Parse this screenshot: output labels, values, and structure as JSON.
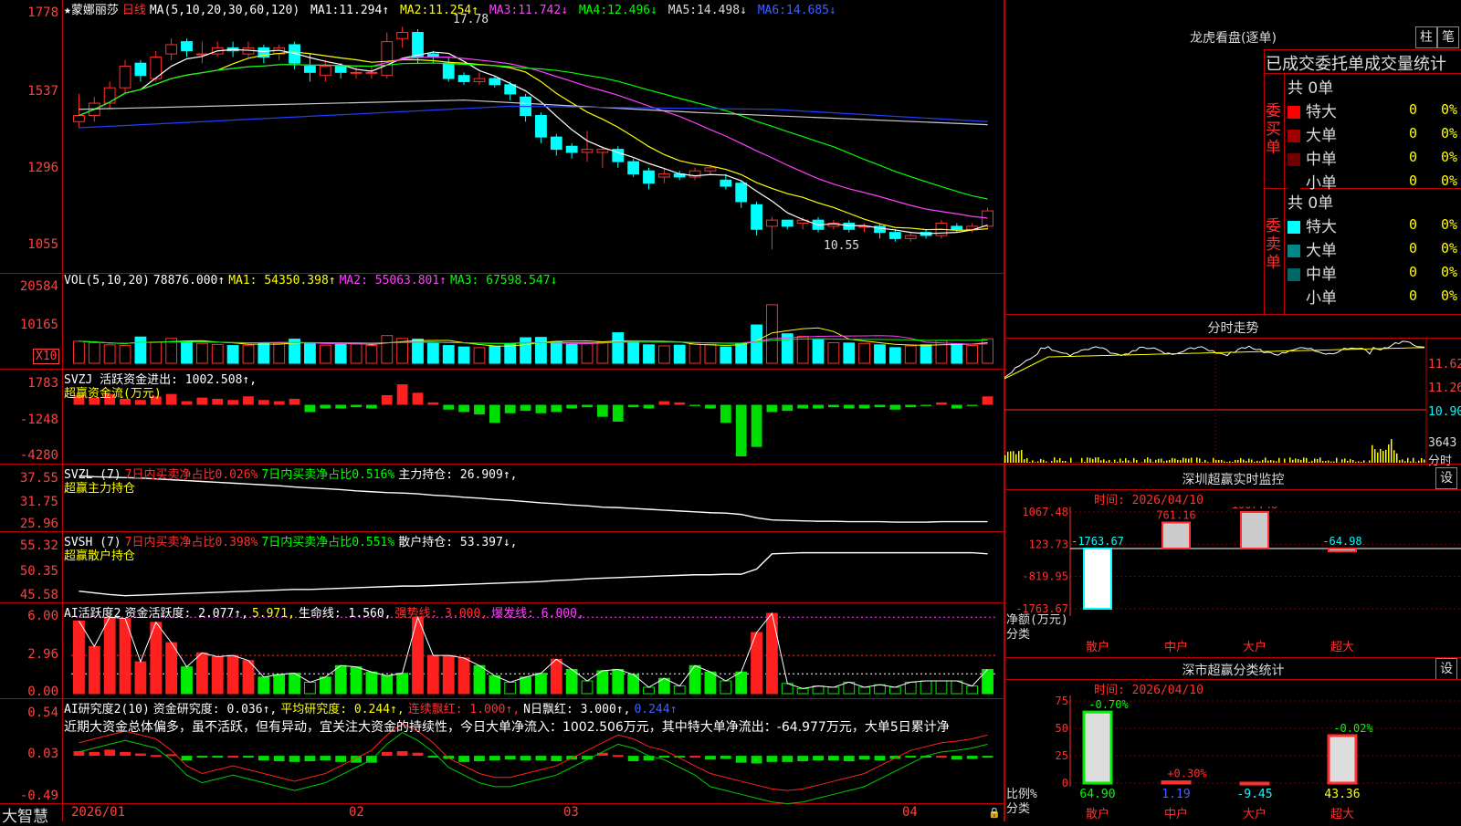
{
  "stock": {
    "name": "★蒙娜丽莎",
    "period": "日线"
  },
  "price_panel": {
    "ma_prefix": "MA(5,10,20,30,60,120)",
    "ma": [
      {
        "label": "MA1:",
        "value": "11.294↑",
        "color": "#ffffff"
      },
      {
        "label": "MA2:",
        "value": "11.254↑",
        "color": "#ffff00"
      },
      {
        "label": "MA3:",
        "value": "11.742↓",
        "color": "#ff40ff"
      },
      {
        "label": "MA4:",
        "value": "12.496↓",
        "color": "#00ff00"
      },
      {
        "label": "MA5:",
        "value": "14.498↓",
        "color": "#dddddd"
      },
      {
        "label": "MA6:",
        "value": "14.685↓",
        "color": "#4060ff"
      }
    ],
    "y_ticks": [
      "1778",
      "1537",
      "1296",
      "1055"
    ],
    "high_mark": "17.78",
    "low_mark": "10.55"
  },
  "vol_panel": {
    "prefix": "VOL(5,10,20)",
    "value": "78876.000↑",
    "ma1": "MA1: 54350.398↑",
    "ma2": "MA2: 55063.801↑",
    "ma3": "MA3: 67598.547↓",
    "y_ticks": [
      "20584",
      "10165"
    ],
    "unit": "X10"
  },
  "svzj_panel": {
    "line1": "SVZJ  活跃资金进出: 1002.508↑,",
    "line2": "超赢资金流(万元)",
    "y_ticks": [
      "1783",
      "-1248",
      "-4280"
    ]
  },
  "svzl_panel": {
    "prefix": "SVZL (7)",
    "a": "7日内买卖净占比0.026%",
    "b": "7日内买卖净占比0.516%",
    "c": "主力持仓: 26.909↑,",
    "line2": "超赢主力持仓",
    "y_ticks": [
      "37.55",
      "31.75",
      "25.96"
    ]
  },
  "svsh_panel": {
    "prefix": "SVSH (7)",
    "a": "7日内买卖净占比0.398%",
    "b": "7日内买卖净占比0.551%",
    "c": "散户持仓: 53.397↓,",
    "line2": "超赢散户持仓",
    "y_ticks": [
      "55.32",
      "50.35",
      "45.58"
    ]
  },
  "ai_panel": {
    "prefix": "AI活跃度2",
    "a": "资金活跃度: 2.077↑,",
    "b": "5.971,",
    "c": "生命线: 1.560,",
    "d": "强势线: 3.000,",
    "e": "爆发线: 6.000,",
    "y_ticks": [
      "6.00",
      "2.96",
      "0.00"
    ]
  },
  "ai2_panel": {
    "prefix": "AI研究度2(10)",
    "a": "资金研究度: 0.036↑,",
    "b": "平均研究度: 0.244↑,",
    "c": "连续飘红: 1.000↑,",
    "d": "N日飘红: 3.000↑,",
    "e": "0.244↑",
    "desc": "近期大资金总体偏多，虽不活跃，但有异动，宜关注大资金的持续性，今日大单净流入：1002.506万元，其中特大单净流出：-64.977万元，大单5日累计净",
    "y_ticks": [
      "0.54",
      "0.03",
      "-0.49"
    ]
  },
  "x_axis": {
    "brand": "大智慧",
    "labels": [
      "2026/01",
      "02",
      "03",
      "04"
    ]
  },
  "dragon": {
    "title": "龙虎看盘(逐单)",
    "btn1": "柱",
    "btn2": "笔",
    "header": "已成交委托单成交量统计",
    "buy": {
      "side": "委买单",
      "total": "共 0单",
      "rows": [
        {
          "label": "特大",
          "count": "0",
          "pct": "0%",
          "color": "#ff0000"
        },
        {
          "label": "大单",
          "count": "0",
          "pct": "0%",
          "color": "#a00000"
        },
        {
          "label": "中单",
          "count": "0",
          "pct": "0%",
          "color": "#700000"
        },
        {
          "label": "小单",
          "count": "0",
          "pct": "0%",
          "color": "#000000"
        }
      ]
    },
    "sell": {
      "side": "委卖单",
      "total": "共 0单",
      "rows": [
        {
          "label": "特大",
          "count": "0",
          "pct": "0%",
          "color": "#00ffff"
        },
        {
          "label": "大单",
          "count": "0",
          "pct": "0%",
          "color": "#008888"
        },
        {
          "label": "中单",
          "count": "0",
          "pct": "0%",
          "color": "#006666"
        },
        {
          "label": "小单",
          "count": "0",
          "pct": "0%",
          "color": "#000000"
        }
      ]
    }
  },
  "intraday": {
    "title": "分时走势",
    "labels": [
      "11.62",
      "11.26",
      "10.90",
      "3643",
      "分时"
    ]
  },
  "sz_monitor": {
    "title": "深圳超赢实时监控",
    "btn": "设",
    "time": "时间: 2026/04/10",
    "y_ticks": [
      "1067.48",
      "123.73",
      "-819.95",
      "-1763.67"
    ],
    "y_name": "净额(万元)",
    "x_name": "分类",
    "bars": [
      {
        "cat": "散户",
        "value": "-1763.67"
      },
      {
        "cat": "中户",
        "value": "761.16"
      },
      {
        "cat": "大户",
        "value": "1067.48"
      },
      {
        "cat": "超大",
        "value": "-64.98"
      }
    ]
  },
  "sz_stats": {
    "title": "深市超赢分类统计",
    "btn": "设",
    "time": "时间: 2026/04/10",
    "y_ticks": [
      "75",
      "50",
      "25",
      "0"
    ],
    "y_name": "比例%",
    "x_name": "分类",
    "bars": [
      {
        "cat": "散户",
        "pct": "-0.70%",
        "value": "64.90"
      },
      {
        "cat": "中户",
        "pct": "+0.30%",
        "value": "1.19"
      },
      {
        "cat": "大户",
        "pct": "",
        "value": "-9.45"
      },
      {
        "cat": "超大",
        "pct": "-0.02%",
        "value": "43.36"
      }
    ]
  },
  "chart_data": [
    {
      "type": "candlestick",
      "title": "蒙娜丽莎 日线",
      "ylim": [
        10.2,
        18.0
      ],
      "candles": [
        [
          14.7,
          14.9,
          14.5,
          15.6
        ],
        [
          14.9,
          15.3,
          14.7,
          15.5
        ],
        [
          15.3,
          15.8,
          15.1,
          16.0
        ],
        [
          15.8,
          16.5,
          15.6,
          16.7
        ],
        [
          16.6,
          16.2,
          16.0,
          16.7
        ],
        [
          16.1,
          16.8,
          16.0,
          17.0
        ],
        [
          16.9,
          17.2,
          16.7,
          17.4
        ],
        [
          17.3,
          17.0,
          16.8,
          17.4
        ],
        [
          16.9,
          16.9,
          16.6,
          17.3
        ],
        [
          16.9,
          17.1,
          16.8,
          17.3
        ],
        [
          17.1,
          17.0,
          16.8,
          17.3
        ],
        [
          16.9,
          17.1,
          16.8,
          17.3
        ],
        [
          17.1,
          16.8,
          16.6,
          17.2
        ],
        [
          16.9,
          17.1,
          16.7,
          17.2
        ],
        [
          17.2,
          16.6,
          16.4,
          17.3
        ],
        [
          16.5,
          16.3,
          16.0,
          16.9
        ],
        [
          16.2,
          16.5,
          16.0,
          16.7
        ],
        [
          16.5,
          16.3,
          16.1,
          16.6
        ],
        [
          16.3,
          16.3,
          16.1,
          16.5
        ],
        [
          16.3,
          16.3,
          16.1,
          16.5
        ],
        [
          16.2,
          17.3,
          16.1,
          17.6
        ],
        [
          17.4,
          17.6,
          17.1,
          17.78
        ],
        [
          17.6,
          16.8,
          16.6,
          17.7
        ],
        [
          16.9,
          16.8,
          16.6,
          17.0
        ],
        [
          16.6,
          16.1,
          16.0,
          16.8
        ],
        [
          16.2,
          16.0,
          15.9,
          16.3
        ],
        [
          16.0,
          16.1,
          15.9,
          16.3
        ],
        [
          16.1,
          15.9,
          15.8,
          16.2
        ],
        [
          15.9,
          15.6,
          15.4,
          16.0
        ],
        [
          15.5,
          14.9,
          14.7,
          15.6
        ],
        [
          14.9,
          14.2,
          14.0,
          15.0
        ],
        [
          14.2,
          13.8,
          13.6,
          14.3
        ],
        [
          13.9,
          13.7,
          13.5,
          14.0
        ],
        [
          13.7,
          13.8,
          13.4,
          14.4
        ],
        [
          13.7,
          13.8,
          13.2,
          13.9
        ],
        [
          13.8,
          13.4,
          13.2,
          13.9
        ],
        [
          13.4,
          13.0,
          12.9,
          13.5
        ],
        [
          13.1,
          12.7,
          12.5,
          13.2
        ],
        [
          12.9,
          13.0,
          12.7,
          13.2
        ],
        [
          13.0,
          12.9,
          12.8,
          13.1
        ],
        [
          12.9,
          13.1,
          12.8,
          13.2
        ],
        [
          13.1,
          13.2,
          13.0,
          13.3
        ],
        [
          12.8,
          12.6,
          12.5,
          13.0
        ],
        [
          12.7,
          12.1,
          11.9,
          12.8
        ],
        [
          12.0,
          11.2,
          11.0,
          12.1
        ],
        [
          11.3,
          11.5,
          10.55,
          11.6
        ],
        [
          11.5,
          11.3,
          11.2,
          11.5
        ],
        [
          11.4,
          11.5,
          11.2,
          11.6
        ],
        [
          11.5,
          11.2,
          11.1,
          11.6
        ],
        [
          11.3,
          11.4,
          11.2,
          11.5
        ],
        [
          11.4,
          11.2,
          11.1,
          11.5
        ],
        [
          11.3,
          11.3,
          11.1,
          11.4
        ],
        [
          11.3,
          11.1,
          10.9,
          11.4
        ],
        [
          11.1,
          10.9,
          10.8,
          11.2
        ],
        [
          10.9,
          11.0,
          10.8,
          11.1
        ],
        [
          11.1,
          11.0,
          10.9,
          11.2
        ],
        [
          11.0,
          11.4,
          10.9,
          11.5
        ],
        [
          11.3,
          11.2,
          11.1,
          11.4
        ],
        [
          11.2,
          11.3,
          11.1,
          11.4
        ],
        [
          11.3,
          11.8,
          11.2,
          11.9
        ]
      ]
    },
    {
      "type": "bar",
      "title": "VOL",
      "ylim": [
        0,
        20584
      ],
      "values": [
        6200,
        5800,
        5200,
        5000,
        7400,
        6000,
        7000,
        5900,
        5600,
        5300,
        5000,
        5100,
        5800,
        5700,
        6800,
        5500,
        5100,
        5300,
        5400,
        5000,
        7800,
        7000,
        6800,
        5600,
        5000,
        4600,
        4400,
        4800,
        5400,
        7200,
        7300,
        6100,
        5300,
        5600,
        5900,
        8600,
        6200,
        5200,
        4900,
        5100,
        5400,
        5300,
        4600,
        5600,
        10800,
        16500,
        8300,
        7600,
        6600,
        5800,
        5700,
        5600,
        5200,
        4400,
        4900,
        5200,
        6400,
        5500,
        5000,
        6900
      ]
    },
    {
      "type": "bar",
      "title": "超赢资金流(万元)",
      "ylim": [
        -4280,
        1783
      ],
      "values": [
        800,
        600,
        900,
        500,
        400,
        700,
        900,
        300,
        600,
        500,
        400,
        700,
        400,
        300,
        500,
        -600,
        -300,
        -300,
        -200,
        -300,
        800,
        1700,
        1000,
        200,
        -400,
        -600,
        -800,
        -1500,
        -700,
        -500,
        -700,
        -600,
        -300,
        -200,
        -1000,
        -1400,
        -200,
        -300,
        300,
        200,
        -100,
        -300,
        -1500,
        -4280,
        -3500,
        -600,
        -500,
        -300,
        -300,
        -200,
        -300,
        -300,
        -200,
        -400,
        -200,
        -100,
        200,
        -300,
        -100,
        700
      ]
    },
    {
      "type": "bar",
      "title": "AI活跃度2",
      "ylim": [
        0,
        6.0
      ],
      "values": [
        5.7,
        3.7,
        6.0,
        5.9,
        2.5,
        5.6,
        4.0,
        2.1,
        3.2,
        2.9,
        3.0,
        2.6,
        1.3,
        1.5,
        1.6,
        0.9,
        1.3,
        2.2,
        2.1,
        1.7,
        1.4,
        1.6,
        6.0,
        3.0,
        3.0,
        2.8,
        2.2,
        1.4,
        0.9,
        1.3,
        1.6,
        2.7,
        1.9,
        1.0,
        1.8,
        1.9,
        1.5,
        0.5,
        1.2,
        0.6,
        2.2,
        1.7,
        1.0,
        1.7,
        4.8,
        6.3,
        0.8,
        0.4,
        0.6,
        0.5,
        0.9,
        0.5,
        0.7,
        0.5,
        0.9,
        1.0,
        1.0,
        1.0,
        0.6,
        1.9
      ]
    },
    {
      "type": "bar",
      "title": "AI研究度2(10)",
      "ylim": [
        -0.49,
        0.54
      ],
      "values": [
        0.09,
        0.08,
        0.11,
        0.08,
        0.06,
        0.04,
        0.05,
        -0.03,
        0.02,
        0.02,
        0.03,
        0.02,
        -0.03,
        -0.04,
        -0.05,
        -0.04,
        -0.03,
        -0.05,
        -0.06,
        -0.06,
        0.08,
        0.09,
        0.07,
        0.02,
        -0.01,
        -0.05,
        -0.04,
        -0.03,
        -0.02,
        -0.03,
        -0.03,
        -0.04,
        -0.02,
        -0.02,
        0.07,
        0.04,
        -0.04,
        -0.03,
        0.02,
        0.01,
        0.03,
        -0.02,
        -0.01,
        -0.06,
        -0.07,
        -0.05,
        -0.05,
        -0.04,
        -0.03,
        -0.03,
        -0.04,
        -0.02,
        -0.03,
        -0.01,
        0.01,
        0.02,
        0.03,
        -0.02,
        -0.01,
        0.02
      ]
    }
  ]
}
